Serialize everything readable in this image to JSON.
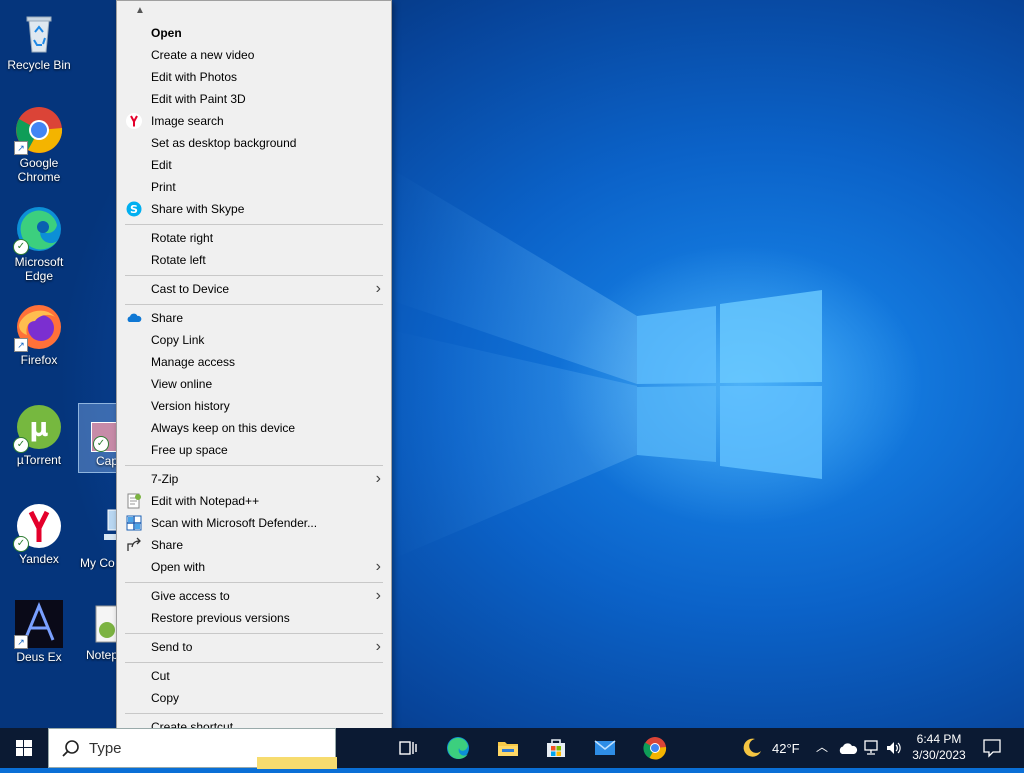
{
  "desktop": {
    "icons": [
      {
        "label": "Recycle Bin"
      },
      {
        "label": "Google Chrome"
      },
      {
        "label": "Microsoft Edge"
      },
      {
        "label": "Firefox"
      },
      {
        "label": "µTorrent"
      },
      {
        "label": "Cap"
      },
      {
        "label": "Yandex"
      },
      {
        "label": "My Co"
      },
      {
        "label": "Deus Ex"
      },
      {
        "label": "Notep"
      }
    ]
  },
  "context_menu": {
    "items": [
      {
        "label": "Open"
      },
      {
        "label": "Create a new video"
      },
      {
        "label": "Edit with Photos"
      },
      {
        "label": "Edit with Paint 3D"
      },
      {
        "label": "Image search"
      },
      {
        "label": "Set as desktop background"
      },
      {
        "label": "Edit"
      },
      {
        "label": "Print"
      },
      {
        "label": "Share with Skype"
      },
      {
        "label": "Rotate right"
      },
      {
        "label": "Rotate left"
      },
      {
        "label": "Cast to Device"
      },
      {
        "label": "Share"
      },
      {
        "label": "Copy Link"
      },
      {
        "label": "Manage access"
      },
      {
        "label": "View online"
      },
      {
        "label": "Version history"
      },
      {
        "label": "Always keep on this device"
      },
      {
        "label": "Free up space"
      },
      {
        "label": "7-Zip"
      },
      {
        "label": "Edit with Notepad++"
      },
      {
        "label": "Scan with Microsoft Defender..."
      },
      {
        "label": "Share"
      },
      {
        "label": "Open with"
      },
      {
        "label": "Give access to"
      },
      {
        "label": "Restore previous versions"
      },
      {
        "label": "Send to"
      },
      {
        "label": "Cut"
      },
      {
        "label": "Copy"
      },
      {
        "label": "Create shortcut"
      }
    ]
  },
  "taskbar": {
    "search_placeholder": "Type",
    "weather": "42°F",
    "time": "6:44 PM",
    "date": "3/30/2023"
  },
  "colors": {
    "accent": "#0078d7",
    "taskbar_bg": "#0b1a33",
    "menu_bg": "#f0f0f0"
  }
}
